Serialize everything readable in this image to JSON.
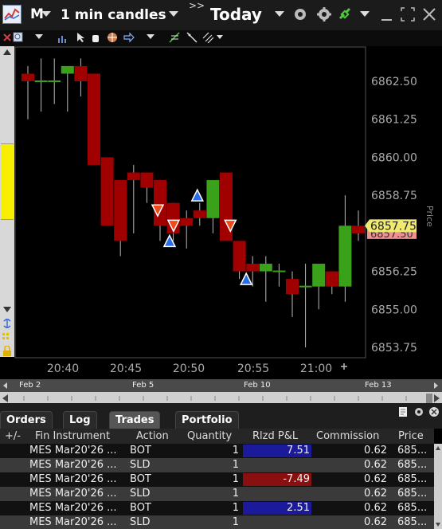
{
  "window": {
    "symbol_short": "M",
    "bar_size": "1 min candles",
    "chevrons": ">>",
    "period": "Today"
  },
  "chart": {
    "y_axis_title": "Price",
    "price_ticks": [
      "6862.50",
      "6861.25",
      "6860.00",
      "6858.75",
      "6857.50",
      "6856.25",
      "6855.00",
      "6853.75"
    ],
    "time_ticks": [
      "20:40",
      "20:45",
      "20:50",
      "20:55",
      "21:00"
    ],
    "last_price": "6857.75",
    "bid_price": "6857.50"
  },
  "chart_data": {
    "type": "candlestick",
    "interval": "1 min",
    "ylabel": "Price",
    "candles": [
      {
        "o": 6862.75,
        "h": 6863.0,
        "l": 6861.25,
        "c": 6862.5
      },
      {
        "o": 6862.5,
        "h": 6863.25,
        "l": 6861.5,
        "c": 6862.5
      },
      {
        "o": 6862.5,
        "h": 6863.25,
        "l": 6861.75,
        "c": 6862.5
      },
      {
        "o": 6862.75,
        "h": 6863.0,
        "l": 6861.5,
        "c": 6863.0
      },
      {
        "o": 6863.0,
        "h": 6863.25,
        "l": 6862.0,
        "c": 6862.5
      },
      {
        "o": 6862.75,
        "h": 6862.75,
        "l": 6859.75,
        "c": 6859.75
      },
      {
        "o": 6860.0,
        "h": 6860.0,
        "l": 6857.75,
        "c": 6857.75
      },
      {
        "o": 6859.25,
        "h": 6859.25,
        "l": 6856.75,
        "c": 6857.25
      },
      {
        "o": 6859.5,
        "h": 6859.75,
        "l": 6857.5,
        "c": 6859.25
      },
      {
        "o": 6859.5,
        "h": 6859.5,
        "l": 6858.5,
        "c": 6859.0
      },
      {
        "o": 6859.25,
        "h": 6859.25,
        "l": 6857.25,
        "c": 6857.75
      },
      {
        "o": 6858.5,
        "h": 6858.5,
        "l": 6857.25,
        "c": 6857.5
      },
      {
        "o": 6858.0,
        "h": 6858.25,
        "l": 6857.0,
        "c": 6857.75
      },
      {
        "o": 6858.25,
        "h": 6858.5,
        "l": 6857.75,
        "c": 6858.0
      },
      {
        "o": 6858.0,
        "h": 6859.25,
        "l": 6857.5,
        "c": 6859.25
      },
      {
        "o": 6859.5,
        "h": 6859.5,
        "l": 6857.25,
        "c": 6857.25
      },
      {
        "o": 6857.25,
        "h": 6857.25,
        "l": 6856.0,
        "c": 6856.25
      },
      {
        "o": 6856.5,
        "h": 6856.75,
        "l": 6855.75,
        "c": 6856.25
      },
      {
        "o": 6856.25,
        "h": 6856.75,
        "l": 6855.25,
        "c": 6856.5
      },
      {
        "o": 6856.25,
        "h": 6856.5,
        "l": 6855.75,
        "c": 6856.25
      },
      {
        "o": 6856.0,
        "h": 6856.25,
        "l": 6854.75,
        "c": 6855.5
      },
      {
        "o": 6855.75,
        "h": 6856.5,
        "l": 6853.75,
        "c": 6855.75
      },
      {
        "o": 6855.75,
        "h": 6856.5,
        "l": 6855.0,
        "c": 6856.5
      },
      {
        "o": 6856.25,
        "h": 6856.25,
        "l": 6855.5,
        "c": 6855.75
      },
      {
        "o": 6855.75,
        "h": 6858.75,
        "l": 6855.25,
        "c": 6857.75
      },
      {
        "o": 6857.75,
        "h": 6858.25,
        "l": 6857.25,
        "c": 6857.5
      }
    ],
    "trade_markers": [
      {
        "type": "sell",
        "bar": 10.3,
        "price": 6858.25
      },
      {
        "type": "buy",
        "bar": 11.2,
        "price": 6857.25
      },
      {
        "type": "sell",
        "bar": 11.5,
        "price": 6857.75
      },
      {
        "type": "buy",
        "bar": 13.3,
        "price": 6858.75
      },
      {
        "type": "sell",
        "bar": 15.8,
        "price": 6857.75
      },
      {
        "type": "buy",
        "bar": 17.0,
        "price": 6856.0
      }
    ]
  },
  "date_nav": [
    "Feb 2",
    "Feb 5",
    "Feb 10",
    "Feb 13"
  ],
  "trade_panel": {
    "tabs": [
      "Orders",
      "Log",
      "Trades",
      "Portfolio"
    ],
    "active_tab": "Trades",
    "columns": [
      "+/-",
      "Fin Instrument",
      "Action",
      "Quantity",
      "Rlzd P&L",
      "Commission",
      "Price"
    ],
    "rows": [
      {
        "instrument": "MES Mar20'26 ...",
        "action": "BOT",
        "qty": "1",
        "pnl": "7.51",
        "pnl_sign": "pos",
        "commission": "0.62",
        "price": "685..."
      },
      {
        "instrument": "MES Mar20'26 ...",
        "action": "SLD",
        "qty": "1",
        "pnl": "",
        "pnl_sign": "",
        "commission": "0.62",
        "price": "685..."
      },
      {
        "instrument": "MES Mar20'26 ...",
        "action": "BOT",
        "qty": "1",
        "pnl": "-7.49",
        "pnl_sign": "neg",
        "commission": "0.62",
        "price": "685..."
      },
      {
        "instrument": "MES Mar20'26 ...",
        "action": "SLD",
        "qty": "1",
        "pnl": "",
        "pnl_sign": "",
        "commission": "0.62",
        "price": "685..."
      },
      {
        "instrument": "MES Mar20'26 ...",
        "action": "BOT",
        "qty": "1",
        "pnl": "2.51",
        "pnl_sign": "pos",
        "commission": "0.62",
        "price": "685..."
      },
      {
        "instrument": "MES Mar20'26 ...",
        "action": "SLD",
        "qty": "1",
        "pnl": "",
        "pnl_sign": "",
        "commission": "0.62",
        "price": "685..."
      }
    ]
  },
  "colors": {
    "up_candle": "#3aa11b",
    "down_candle": "#a00000",
    "buy_marker": "#2a6be8",
    "sell_marker": "#f04a1a",
    "pnl_pos_bg": "#1a1a9a",
    "pnl_neg_bg": "#8a1010",
    "last_price_bg": "#f0ea70",
    "bid_price_bg": "#f09090"
  }
}
